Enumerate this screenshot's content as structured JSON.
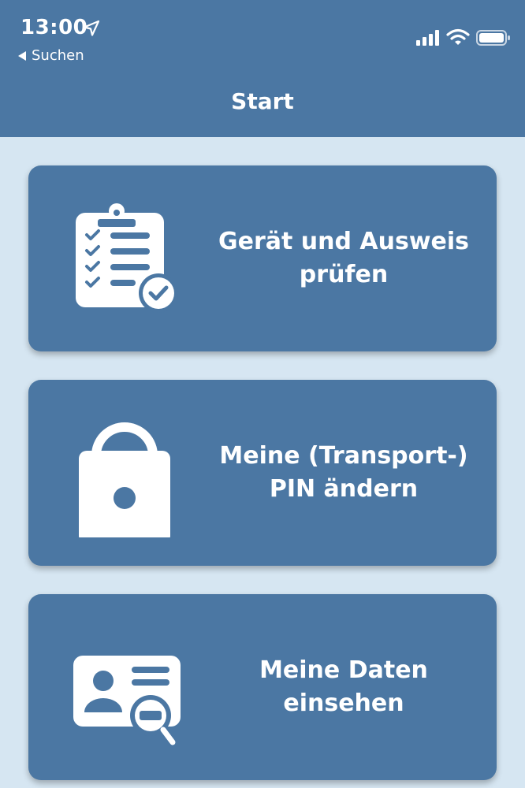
{
  "status_bar": {
    "time": "13:00",
    "back_label": "Suchen"
  },
  "nav": {
    "title": "Start"
  },
  "cards": [
    {
      "label": "Gerät und Ausweis\nprüfen",
      "icon": "clipboard-check-icon"
    },
    {
      "label": "Meine (Transport-)\nPIN ändern",
      "icon": "padlock-icon"
    },
    {
      "label": "Meine Daten einsehen",
      "icon": "id-card-search-icon"
    }
  ],
  "colors": {
    "primary": "#4b77a3",
    "background": "#d6e6f2",
    "text": "#ffffff"
  }
}
